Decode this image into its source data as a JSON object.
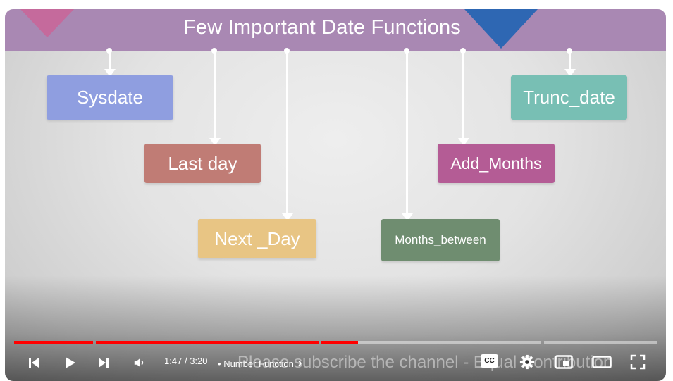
{
  "video": {
    "title": "Few Important Date Functions",
    "boxes": [
      {
        "id": "sysdate",
        "label": "Sysdate",
        "color": "#8f9ee0"
      },
      {
        "id": "last-day",
        "label": "Last day",
        "color": "#c07c75"
      },
      {
        "id": "next-day",
        "label": "Next _Day",
        "color": "#e8c584"
      },
      {
        "id": "months-between",
        "label": "Months_between",
        "color": "#6f8d70"
      },
      {
        "id": "add-months",
        "label": "Add_Months",
        "color": "#b45c95"
      },
      {
        "id": "trunc-date",
        "label": "Trunc_date",
        "color": "#78bfb4"
      }
    ],
    "overlay_text": "Please subscribe the channel - Equal Contribution"
  },
  "player": {
    "current_time": "1:47",
    "duration": "3:20",
    "time_separator": "/",
    "chapter_separator": "•",
    "chapter_title": "Number Function",
    "chapter_chevron": "›",
    "progress_fraction": 0.535,
    "cc_label": "CC",
    "accent_color": "#ff0000",
    "icons": {
      "previous": "skip-previous-icon",
      "play": "play-icon",
      "next": "skip-next-icon",
      "volume": "volume-icon",
      "settings": "gear-icon",
      "miniplayer": "miniplayer-icon",
      "theater": "theater-mode-icon",
      "fullscreen": "fullscreen-icon"
    }
  }
}
